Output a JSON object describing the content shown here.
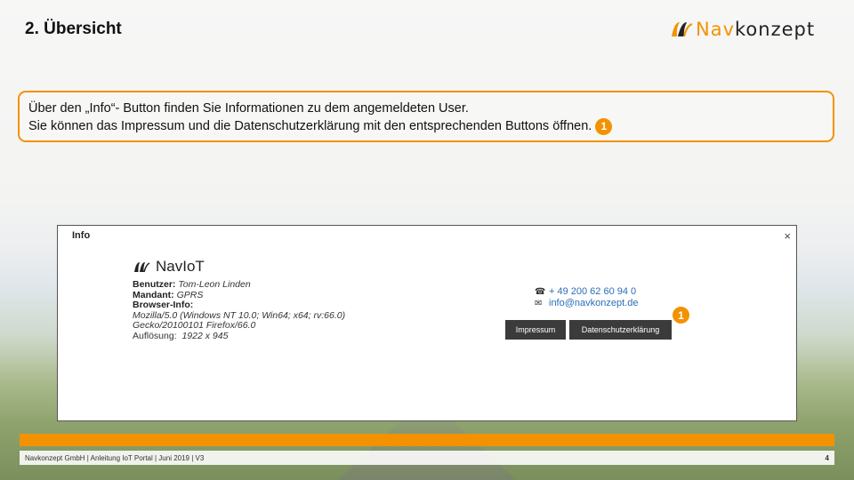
{
  "slide": {
    "title": "2. Übersicht",
    "logo_text_prefix": "Nav",
    "logo_text_suffix": "konzept",
    "accent_color": "#f39200"
  },
  "callout": {
    "line1": "Über den „Info“- Button finden Sie Informationen zu dem angemeldeten User.",
    "line2": "Sie können das Impressum und die Datenschutzerklärung mit den entsprechenden Buttons öffnen.",
    "badge": "1"
  },
  "dialog": {
    "title": "Info",
    "close_icon": "×",
    "app_name": "NavIoT",
    "user_label": "Benutzer:",
    "user_value": "Tom-Leon Linden",
    "client_label": "Mandant:",
    "client_value": "GPRS",
    "browser_label": "Browser-Info:",
    "browser_line1": "Mozilla/5.0 (Windows NT 10.0; Win64; x64; rv:66.0)",
    "browser_line2": "Gecko/20100101 Firefox/66.0",
    "resolution_label": "Auflösung:",
    "resolution_value": "1922 x 945",
    "phone": "+ 49 200 62 60 94 0",
    "email": "info@navkonzept.de",
    "impressum_label": "Impressum",
    "datenschutz_label": "Datenschutzerklärung",
    "badge": "1"
  },
  "footer": {
    "text": "Navkonzept GmbH  |  Anleitung IoT Portal  |  Juni 2019  |  V3",
    "page": "4"
  }
}
